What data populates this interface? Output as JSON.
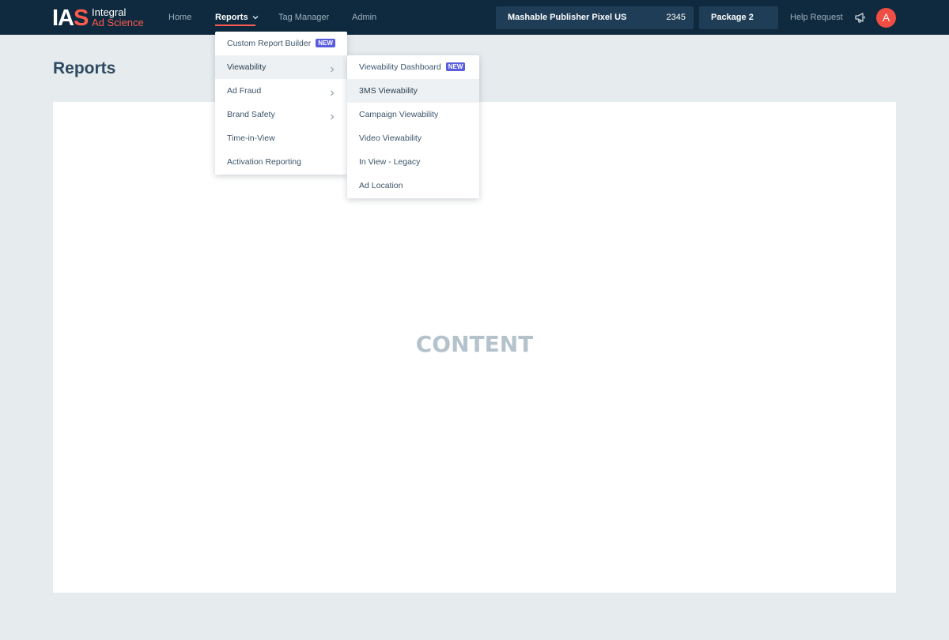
{
  "header": {
    "logo": {
      "mark": "IAS",
      "line1": "Integral",
      "line2": "Ad Science"
    },
    "nav": [
      {
        "label": "Home",
        "active": false
      },
      {
        "label": "Reports",
        "active": true
      },
      {
        "label": "Tag Manager",
        "active": false
      },
      {
        "label": "Admin",
        "active": false
      }
    ],
    "publisher_selector": {
      "name": "Mashable Publisher Pixel US",
      "id": "2345"
    },
    "package_selector": {
      "name": "Package 2"
    },
    "help_label": "Help Request",
    "avatar_initial": "A",
    "icons": {
      "announcements": "megaphone-icon",
      "nav_dropdown": "chevron-down-icon"
    }
  },
  "page": {
    "title": "Reports",
    "content_placeholder": "CONTENT"
  },
  "reports_menu": {
    "items": [
      {
        "label": "Custom Report Builder",
        "badge": "NEW"
      },
      {
        "label": "Viewability",
        "has_submenu": true,
        "highlighted": true
      },
      {
        "label": "Ad Fraud",
        "has_submenu": true
      },
      {
        "label": "Brand Safety",
        "has_submenu": true
      },
      {
        "label": "Time-in-View"
      },
      {
        "label": "Activation Reporting"
      }
    ]
  },
  "viewability_submenu": {
    "items": [
      {
        "label": "Viewability Dashboard",
        "badge": "NEW"
      },
      {
        "label": "3MS Viewability",
        "highlighted": true
      },
      {
        "label": "Campaign Viewability"
      },
      {
        "label": "Video Viewability"
      },
      {
        "label": "In View - Legacy"
      },
      {
        "label": "Ad Location"
      }
    ]
  },
  "colors": {
    "topbar": "#0f2a3e",
    "accent": "#ff5a4e",
    "badge": "#5a5ce0",
    "background": "#e6ebee"
  }
}
